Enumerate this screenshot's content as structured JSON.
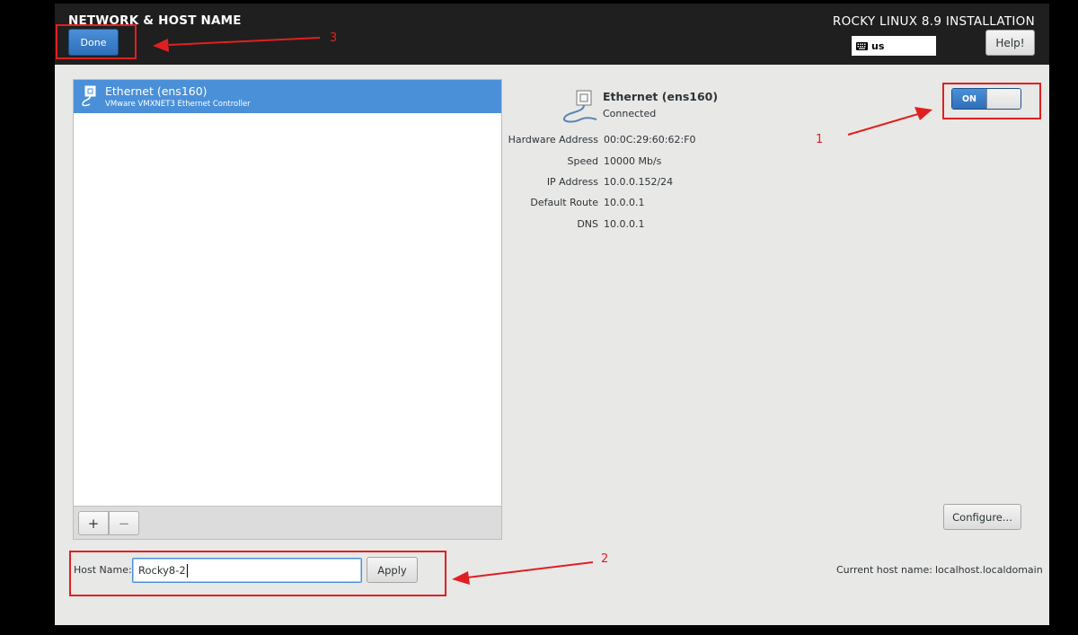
{
  "header": {
    "spoke_title": "NETWORK & HOST NAME",
    "done_label": "Done",
    "product_title": "ROCKY LINUX 8.9 INSTALLATION",
    "keyboard_layout": "us",
    "help_label": "Help!"
  },
  "device_list": {
    "items": [
      {
        "name": "Ethernet (ens160)",
        "description": "VMware VMXNET3 Ethernet Controller",
        "selected": true
      }
    ],
    "add_label": "+",
    "remove_label": "−"
  },
  "device_details": {
    "name": "Ethernet (ens160)",
    "status": "Connected",
    "toggle_label": "ON",
    "properties": [
      {
        "label": "Hardware Address",
        "value": "00:0C:29:60:62:F0"
      },
      {
        "label": "Speed",
        "value": "10000 Mb/s"
      },
      {
        "label": "IP Address",
        "value": "10.0.0.152/24"
      },
      {
        "label": "Default Route",
        "value": "10.0.0.1"
      },
      {
        "label": "DNS",
        "value": "10.0.0.1"
      }
    ],
    "configure_label": "Configure..."
  },
  "hostname": {
    "label": "Host Name:",
    "value": "Rocky8-2",
    "apply_label": "Apply",
    "current_label": "Current host name:",
    "current_value": "localhost.localdomain"
  },
  "annotations": {
    "labels": [
      "1",
      "2",
      "3"
    ],
    "color": "#e02020"
  },
  "colors": {
    "accent": "#4a90d9",
    "topbar": "#1f1f1f",
    "panel": "#e8e8e7"
  }
}
